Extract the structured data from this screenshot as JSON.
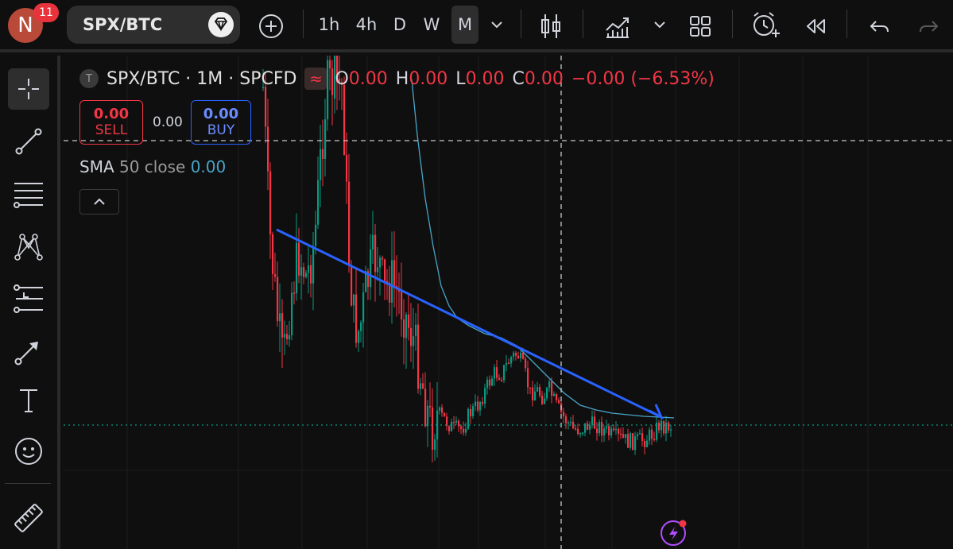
{
  "header": {
    "avatar_initial": "N",
    "notifications": "11",
    "symbol": "SPX/BTC",
    "intervals": [
      "1h",
      "4h",
      "D",
      "W",
      "M"
    ],
    "active_interval": "M"
  },
  "legend": {
    "title": "SPX/BTC · 1M · SPCFD",
    "open_label": "O",
    "open": "0.00",
    "high_label": "H",
    "high": "0.00",
    "low_label": "L",
    "low": "0.00",
    "close_label": "C",
    "close": "0.00",
    "change": "−0.00 (−6.53%)"
  },
  "trade": {
    "sell_value": "0.00",
    "sell_label": "SELL",
    "spread": "0.00",
    "buy_value": "0.00",
    "buy_label": "BUY"
  },
  "indicator": {
    "name": "SMA",
    "params": "50 close",
    "value": "0.00"
  },
  "colors": {
    "up": "#089981",
    "down": "#f23645",
    "sma": "#4aa4c8",
    "trendline": "#2962ff",
    "accent_purple": "#b04dff"
  },
  "icons": {
    "add": "plus-circle-icon",
    "bars": "candles-icon",
    "indicators": "indicators-icon",
    "layout": "layout-grid-icon",
    "alert": "alarm-icon",
    "replay": "replay-icon",
    "undo": "undo-icon",
    "redo": "redo-icon"
  }
}
